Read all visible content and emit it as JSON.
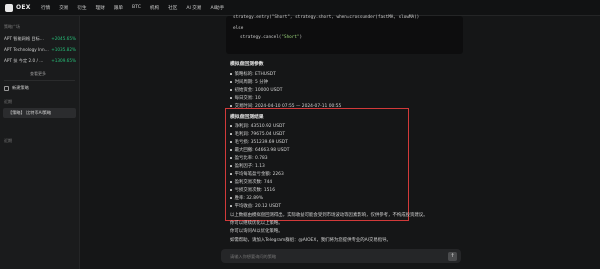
{
  "brand": {
    "logo_text": "OEX"
  },
  "nav": {
    "items": [
      "行情",
      "交易",
      "衍生",
      "理财",
      "跟单",
      "BTC",
      "机构",
      "社区",
      "AI 交易",
      "AI助手"
    ]
  },
  "sidebar": {
    "section_title": "策略广场",
    "rows": [
      {
        "name": "APT 智能网格 目标…",
        "change": "+2045.65%"
      },
      {
        "name": "APT Technology Inn…",
        "change": "+1035.82%"
      },
      {
        "name": "APT 扶 今定 2.0 / …",
        "change": "+1309.65%"
      }
    ],
    "more_label": "查看更多",
    "new_strategy_label": "新建策略",
    "recent_title": "近期",
    "active_item": "【策略】 比特币AI策略",
    "recent_title_2": "近期"
  },
  "code": {
    "line1": "strategy.entry(\"Short\", strategy.short, when=crossunder(fastMA, slowMA))",
    "line2_kw": "else",
    "line3_prefix": "strategy.cancel(",
    "line3_str": "\"Short\"",
    "line3_suffix": ")"
  },
  "settings": {
    "heading": "模拟盘回测参数",
    "items": [
      "策略标的: ETHUSDT",
      "时间周期: 5 分钟",
      "初始资金: 10000 USDT",
      "每日交易: 10",
      "交易时间: 2024-04-10 07:55 — 2024-07-11 00:55"
    ]
  },
  "results": {
    "heading": "模拟盘回测结果",
    "items": [
      "净利润: 43510.92 USDT",
      "毛利润: 79675.04 USDT",
      "毛亏损: 351239.69 USDT",
      "最大回撤: 64663.98 USDT",
      "盈亏比率: 0.783",
      "盈利因子: 1.13",
      "平均每笔盈亏金额: 2263",
      "盈利交易次数: 744",
      "亏损交易次数: 1516",
      "胜率: 32.89%",
      "平均收益: 20.12 USDT"
    ]
  },
  "tail": {
    "line1": "以上数据由模拟盘回测得出，实际收益可能会受到市场波动等因素影响，仅供参考，不构成投资建议。",
    "line2": "你可以继续优化以上策略。",
    "line3": "你可以询问AI以优化策略。",
    "line4": "如需帮助，请加入Telegram群组：@AIOEX，我们将为您提供专业的AI交易指导。"
  },
  "chat_input": {
    "placeholder": "请输入你想要询问的策略"
  },
  "colors": {
    "background": "#151617",
    "highlight_border": "#d23a3a",
    "positive": "#27c07a"
  }
}
